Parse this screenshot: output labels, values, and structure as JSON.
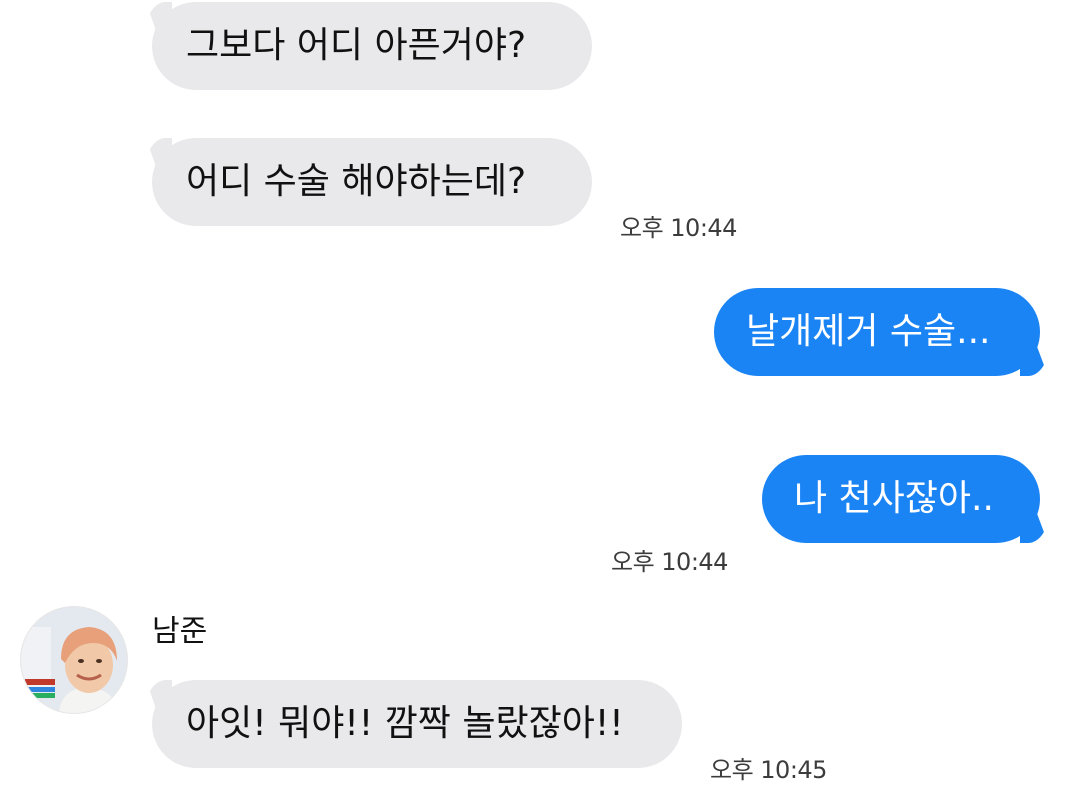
{
  "messages": [
    {
      "text": "그보다 어디 아픈거야?"
    },
    {
      "text": "어디 수술 해야하는데?",
      "time": "오후 10:44"
    },
    {
      "text": "날개제거 수술..."
    },
    {
      "text": "나 천사잖아..",
      "time": "오후 10:44"
    },
    {
      "text": "아잇! 뭐야!! 깜짝 놀랐잖아!!",
      "time": "오후 10:45"
    }
  ],
  "sender": {
    "name": "남준",
    "avatar_icon": "profile-photo"
  },
  "colors": {
    "incoming_bubble": "#e9e9eb",
    "outgoing_bubble": "#1a84f5"
  }
}
